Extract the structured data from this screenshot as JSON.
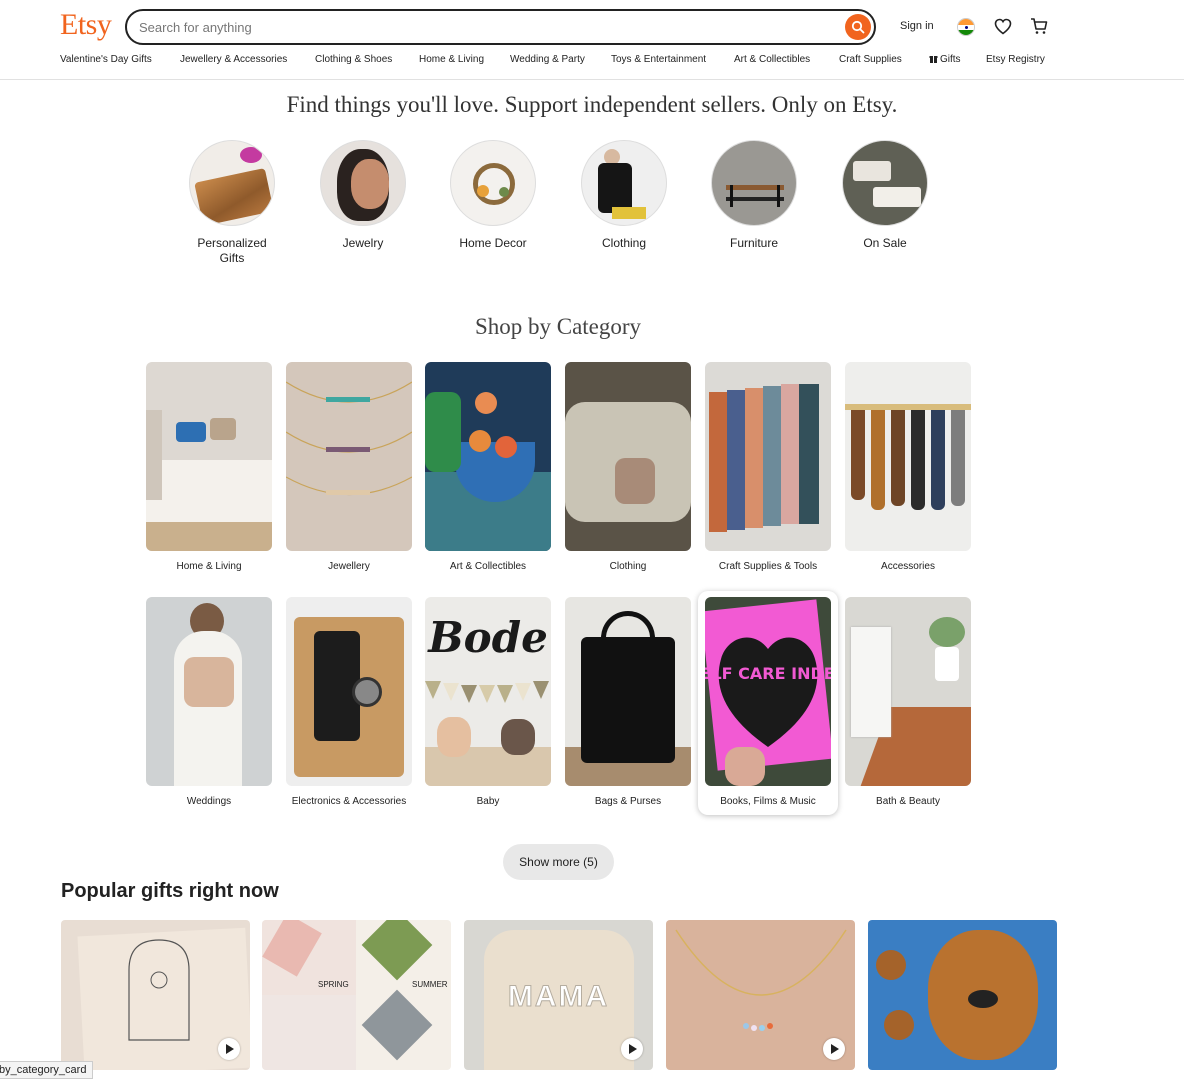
{
  "header": {
    "logo": "Etsy",
    "search_placeholder": "Search for anything",
    "sign_in": "Sign in",
    "nav": [
      "Valentine's Day Gifts",
      "Jewellery & Accessories",
      "Clothing & Shoes",
      "Home & Living",
      "Wedding & Party",
      "Toys & Entertainment",
      "Art & Collectibles",
      "Craft Supplies",
      "Gifts",
      "Etsy Registry"
    ]
  },
  "hero": {
    "tagline": "Find things you'll love. Support independent sellers. Only on Etsy.",
    "circles": [
      "Personalized Gifts",
      "Jewelry",
      "Home Decor",
      "Clothing",
      "Furniture",
      "On Sale"
    ]
  },
  "categories": {
    "title": "Shop by Category",
    "row1": [
      "Home & Living",
      "Jewellery",
      "Art & Collectibles",
      "Clothing",
      "Craft Supplies & Tools",
      "Accessories"
    ],
    "row2": [
      "Weddings",
      "Electronics & Accessories",
      "Baby",
      "Bags & Purses",
      "Books, Films & Music",
      "Bath & Beauty"
    ],
    "show_more": "Show more (5)"
  },
  "popular": {
    "title": "Popular gifts right now",
    "tile_texts": {
      "spring": "SPRING",
      "summer": "SUMMER",
      "mama": "MAMA",
      "bode": "Bode",
      "selfcare": "SELF CARE INDEX"
    }
  },
  "status_tooltip": "by_category_card"
}
